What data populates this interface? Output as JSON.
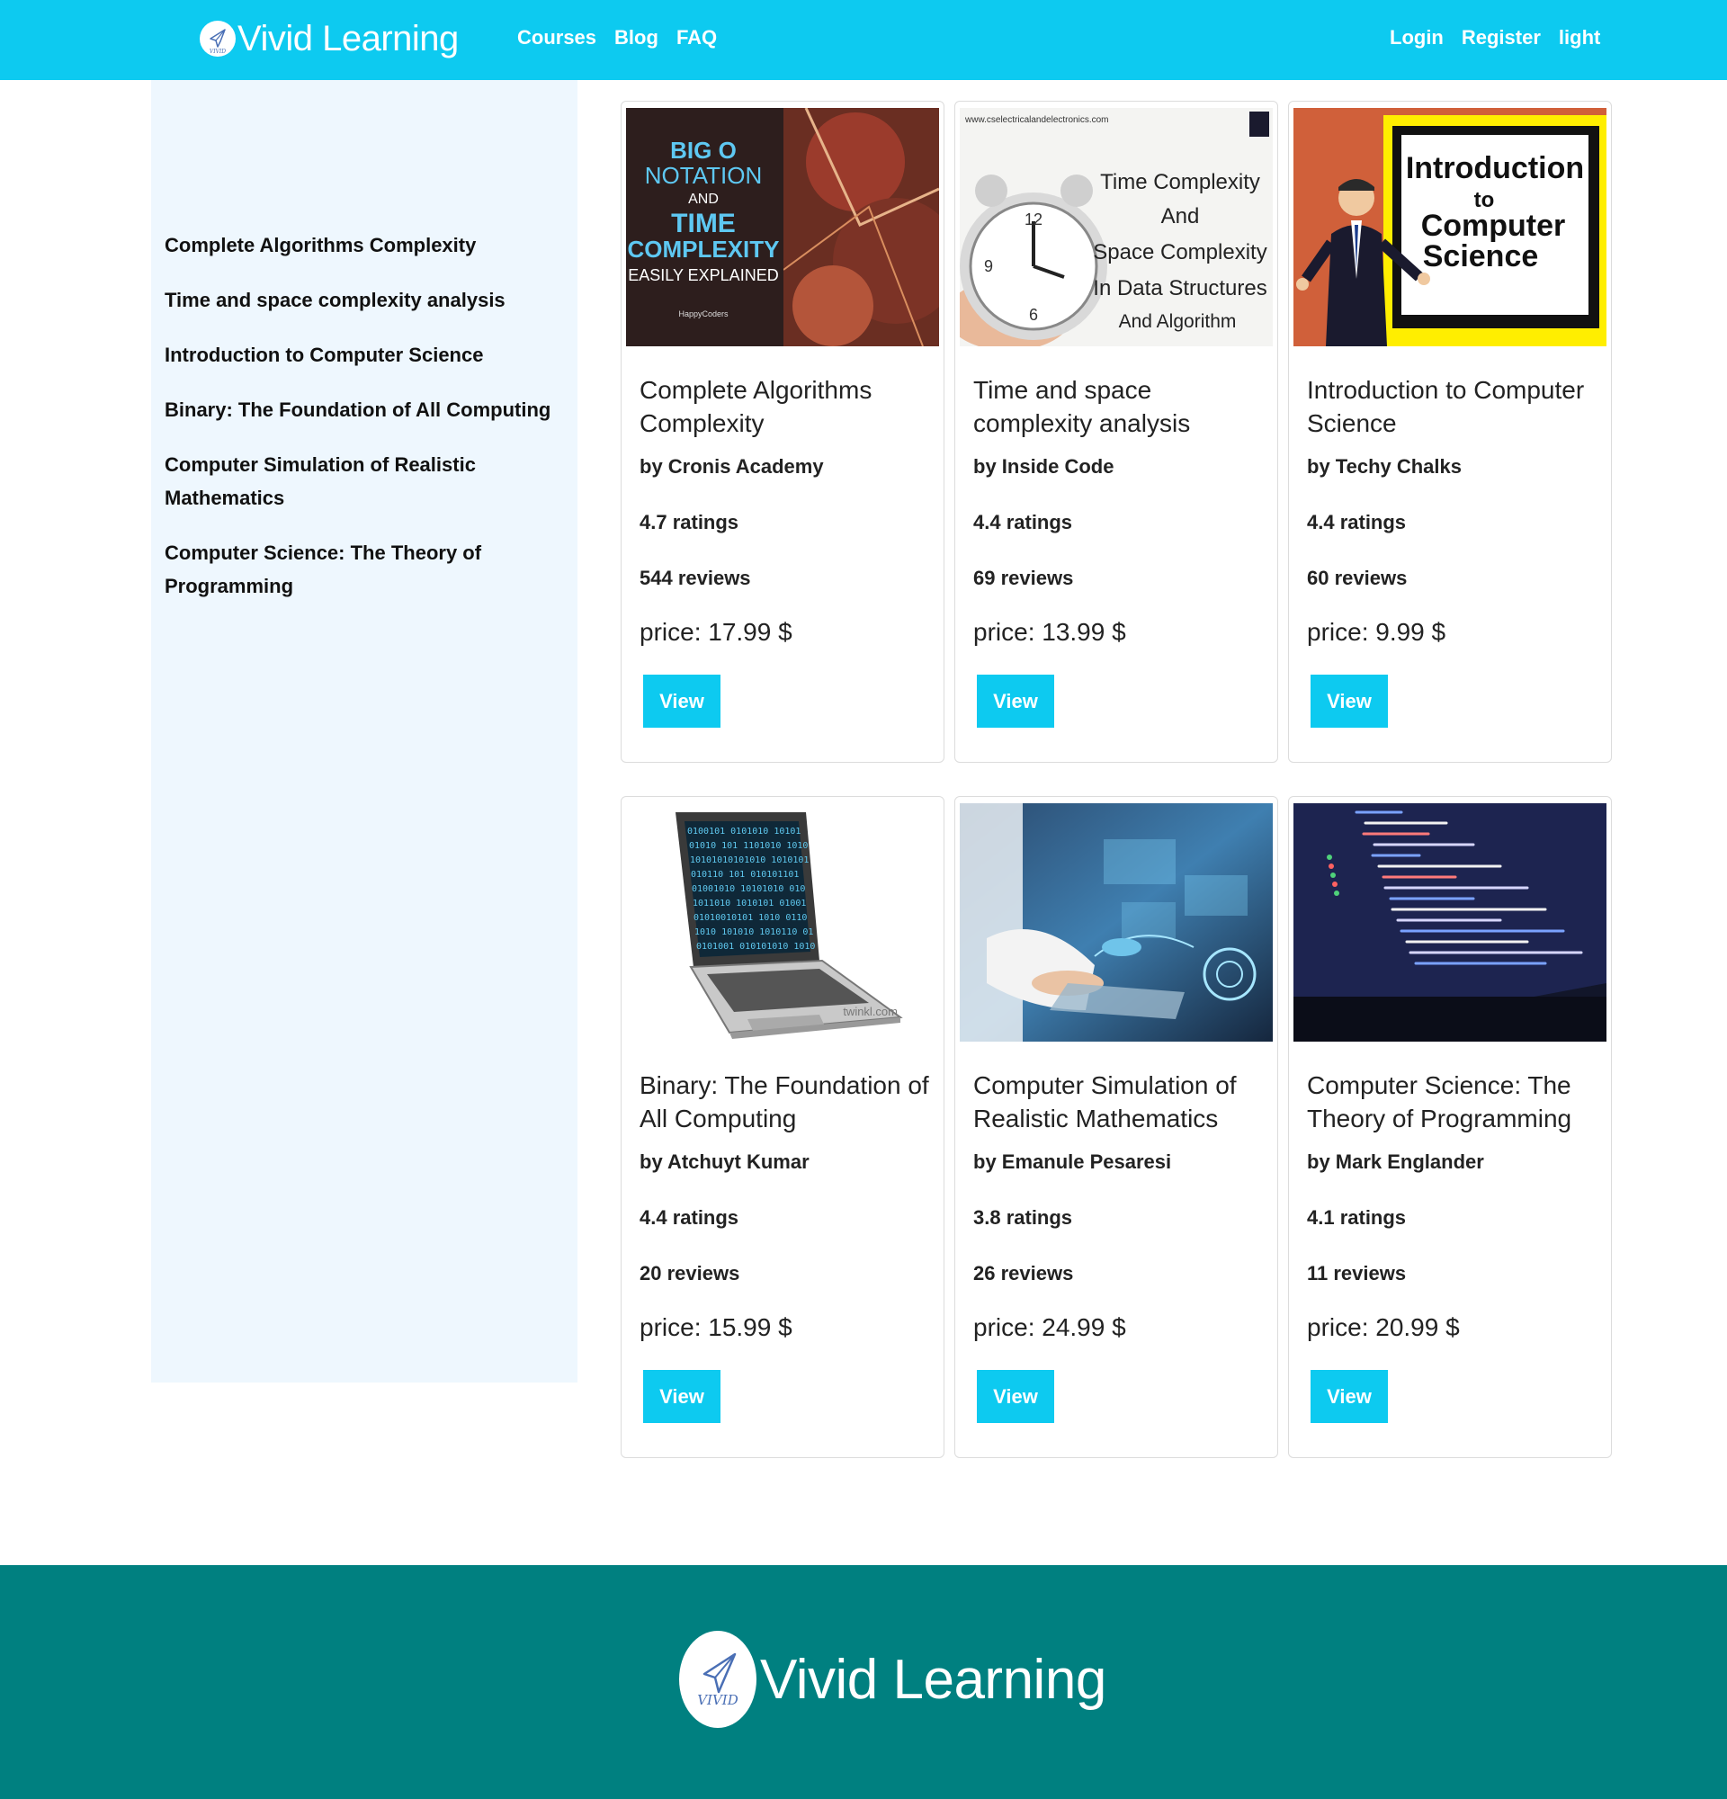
{
  "header": {
    "brand_name": "Vivid Learning",
    "logo_text": "VIVID",
    "nav_left": [
      "Courses",
      "Blog",
      "FAQ"
    ],
    "nav_right": [
      "Login",
      "Register",
      "light"
    ]
  },
  "sidebar": {
    "items": [
      "Complete Algorithms Complexity",
      "Time and space complexity analysis",
      "Introduction to Computer Science",
      "Binary: The Foundation of All Computing",
      "Computer Simulation of Realistic Mathematics",
      "Computer Science: The Theory of Programming"
    ]
  },
  "courses": [
    {
      "title": "Complete Algorithms Complexity",
      "author": "by Cronis Academy",
      "ratings": "4.7 ratings",
      "reviews": "544 reviews",
      "price": "price: 17.99 $",
      "button": "View",
      "thumb": {
        "line1": "BIG O",
        "line2": "NOTATION",
        "line3": "AND",
        "line4": "TIME",
        "line5": "COMPLEXITY",
        "line6": "EASILY EXPLAINED",
        "small": "HappyCoders"
      }
    },
    {
      "title": "Time and space complexity analysis",
      "author": "by Inside Code",
      "ratings": "4.4 ratings",
      "reviews": "69 reviews",
      "price": "price: 13.99 $",
      "button": "View",
      "thumb": {
        "url": "www.cselectricalandelectronics.com",
        "line1": "Time Complexity",
        "line2": "And",
        "line3": "Space Complexity",
        "line4": "In Data Structures",
        "line5": "And Algorithm"
      }
    },
    {
      "title": "Introduction to Computer Science",
      "author": "by Techy Chalks",
      "ratings": "4.4 ratings",
      "reviews": "60 reviews",
      "price": "price: 9.99 $",
      "button": "View",
      "thumb": {
        "line1": "Introduction",
        "line2": "to",
        "line3": "Computer",
        "line4": "Science"
      }
    },
    {
      "title": "Binary: The Foundation of All Computing",
      "author": "by Atchuyt Kumar",
      "ratings": "4.4 ratings",
      "reviews": "20 reviews",
      "price": "price: 15.99 $",
      "button": "View",
      "thumb": {
        "watermark": "twinkl.com"
      }
    },
    {
      "title": "Computer Simulation of Realistic Mathematics",
      "author": "by Emanule Pesaresi",
      "ratings": "3.8 ratings",
      "reviews": "26 reviews",
      "price": "price: 24.99 $",
      "button": "View",
      "thumb": {}
    },
    {
      "title": "Computer Science: The Theory of Programming",
      "author": "by Mark Englander",
      "ratings": "4.1 ratings",
      "reviews": "11 reviews",
      "price": "price: 20.99 $",
      "button": "View",
      "thumb": {}
    }
  ],
  "footer": {
    "brand_name": "Vivid Learning",
    "logo_text": "VIVID"
  },
  "colors": {
    "primary": "#0dcaf0",
    "footer": "#008080",
    "sidebar_bg": "#eef7fe"
  }
}
